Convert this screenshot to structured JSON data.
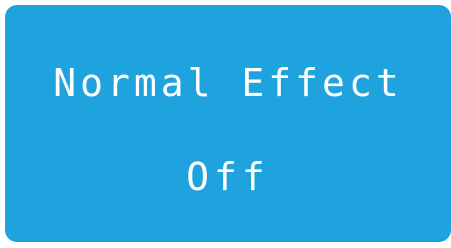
{
  "tile": {
    "title": "Normal Effect",
    "value": "Off",
    "background_color": "#1ea3df",
    "text_color": "#ffffff"
  }
}
